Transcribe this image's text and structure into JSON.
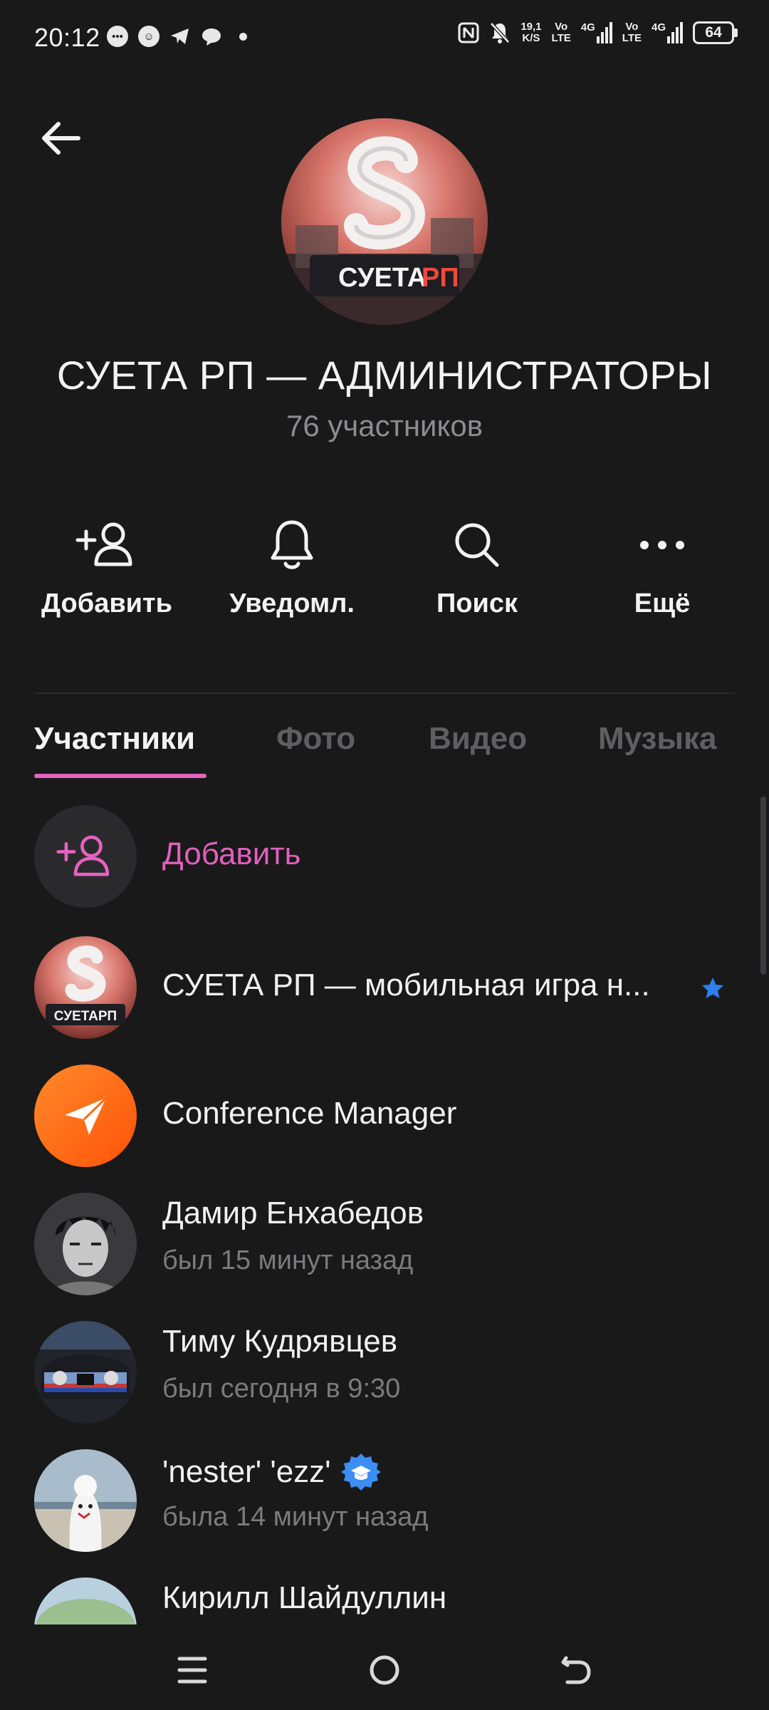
{
  "status_bar": {
    "time": "20:12",
    "speed_value": "19,1",
    "speed_unit": "K/S",
    "volte1": "Vo",
    "lte1": "LTE",
    "net1": "4G",
    "volte2": "Vo",
    "lte2": "LTE",
    "net2": "4G",
    "battery": "64"
  },
  "header": {
    "title": "СУЕТА РП — АДМИНИСТРАТОРЫ",
    "subtitle": "76 участников",
    "avatar_text_main": "СУЕТА",
    "avatar_text_accent": "РП"
  },
  "actions": [
    {
      "label": "Добавить",
      "icon": "add-user-icon"
    },
    {
      "label": "Уведомл.",
      "icon": "bell-icon"
    },
    {
      "label": "Поиск",
      "icon": "search-icon"
    },
    {
      "label": "Ещё",
      "icon": "more-icon"
    }
  ],
  "tabs": [
    "Участники",
    "Фото",
    "Видео",
    "Музыка"
  ],
  "members": {
    "add_label": "Добавить",
    "items": [
      {
        "name": "СУЕТА РП — мобильная игра н...",
        "status": ""
      },
      {
        "name": "Conference Manager",
        "status": ""
      },
      {
        "name": "Дамир Енхабедов",
        "status": "был 15 минут назад"
      },
      {
        "name": "Тиму Кудрявцев",
        "status": "был сегодня в 9:30"
      },
      {
        "name": "'nester' 'ezz'",
        "status": "была 14 минут назад"
      },
      {
        "name": "Кирилл Шайдуллин",
        "status": ""
      }
    ],
    "small_avatar_text": "СУЕТАРП"
  },
  "colors": {
    "accent": "#e563c0",
    "background": "#19191a",
    "star": "#2d7ff0",
    "verified": "#3c8ef3",
    "conference": "#ff6a13"
  }
}
